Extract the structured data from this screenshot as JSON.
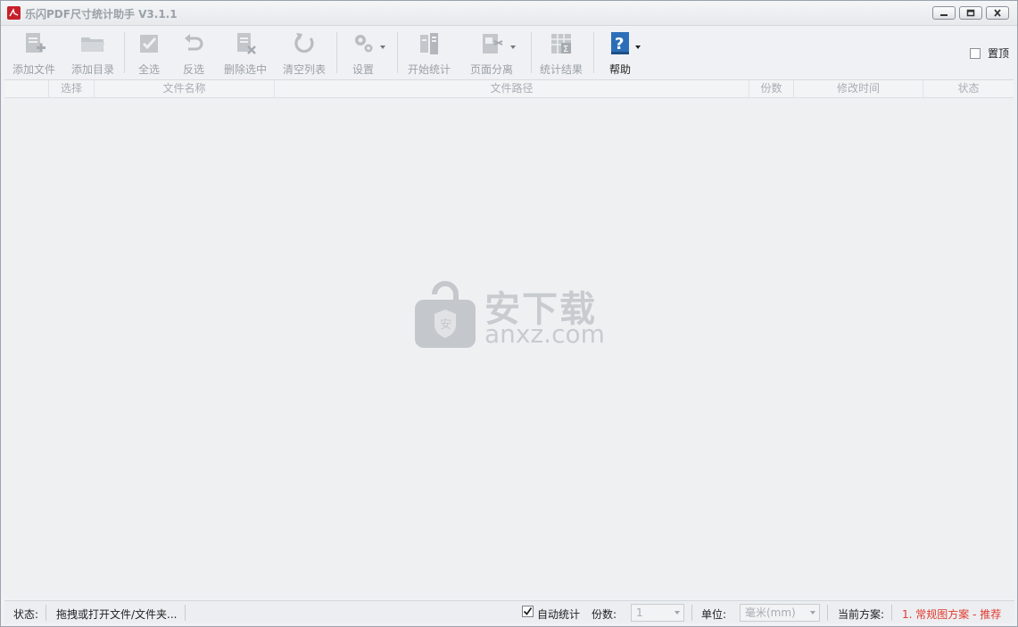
{
  "window": {
    "title": "乐闪PDF尺寸统计助手 V3.1.1"
  },
  "toolbar": {
    "buttons": [
      {
        "label": "添加文件",
        "icon": "add-file-icon"
      },
      {
        "label": "添加目录",
        "icon": "add-folder-icon"
      },
      {
        "label": "全选",
        "icon": "select-all-icon"
      },
      {
        "label": "反选",
        "icon": "invert-selection-icon"
      },
      {
        "label": "删除选中",
        "icon": "delete-selected-icon"
      },
      {
        "label": "清空列表",
        "icon": "clear-list-icon"
      },
      {
        "label": "设置",
        "icon": "settings-icon"
      },
      {
        "label": "开始统计",
        "icon": "start-stats-icon"
      },
      {
        "label": "页面分离",
        "icon": "page-split-icon"
      },
      {
        "label": "统计结果",
        "icon": "stats-result-icon"
      },
      {
        "label": "帮助",
        "icon": "help-icon"
      }
    ],
    "topmost_label": "置顶",
    "topmost_checked": false
  },
  "grid": {
    "columns": [
      "选择",
      "文件名称",
      "文件路径",
      "份数",
      "修改时间",
      "状态"
    ],
    "rows": []
  },
  "watermark": {
    "text": "安下载",
    "sub": "anxz.com"
  },
  "statusbar": {
    "status_label": "状态:",
    "status_text": "拖拽或打开文件/文件夹...",
    "auto_stats_label": "自动统计",
    "auto_stats_checked": true,
    "copies_label": "份数:",
    "copies_value": "1",
    "unit_label": "单位:",
    "unit_value": "毫米(mm)",
    "scheme_label": "当前方案:",
    "scheme_value": "1. 常规图方案 - 推荐"
  },
  "colors": {
    "scheme_accent": "#e23a2e",
    "help_icon": "#2c6fb8",
    "app_icon": "#c8202b"
  }
}
